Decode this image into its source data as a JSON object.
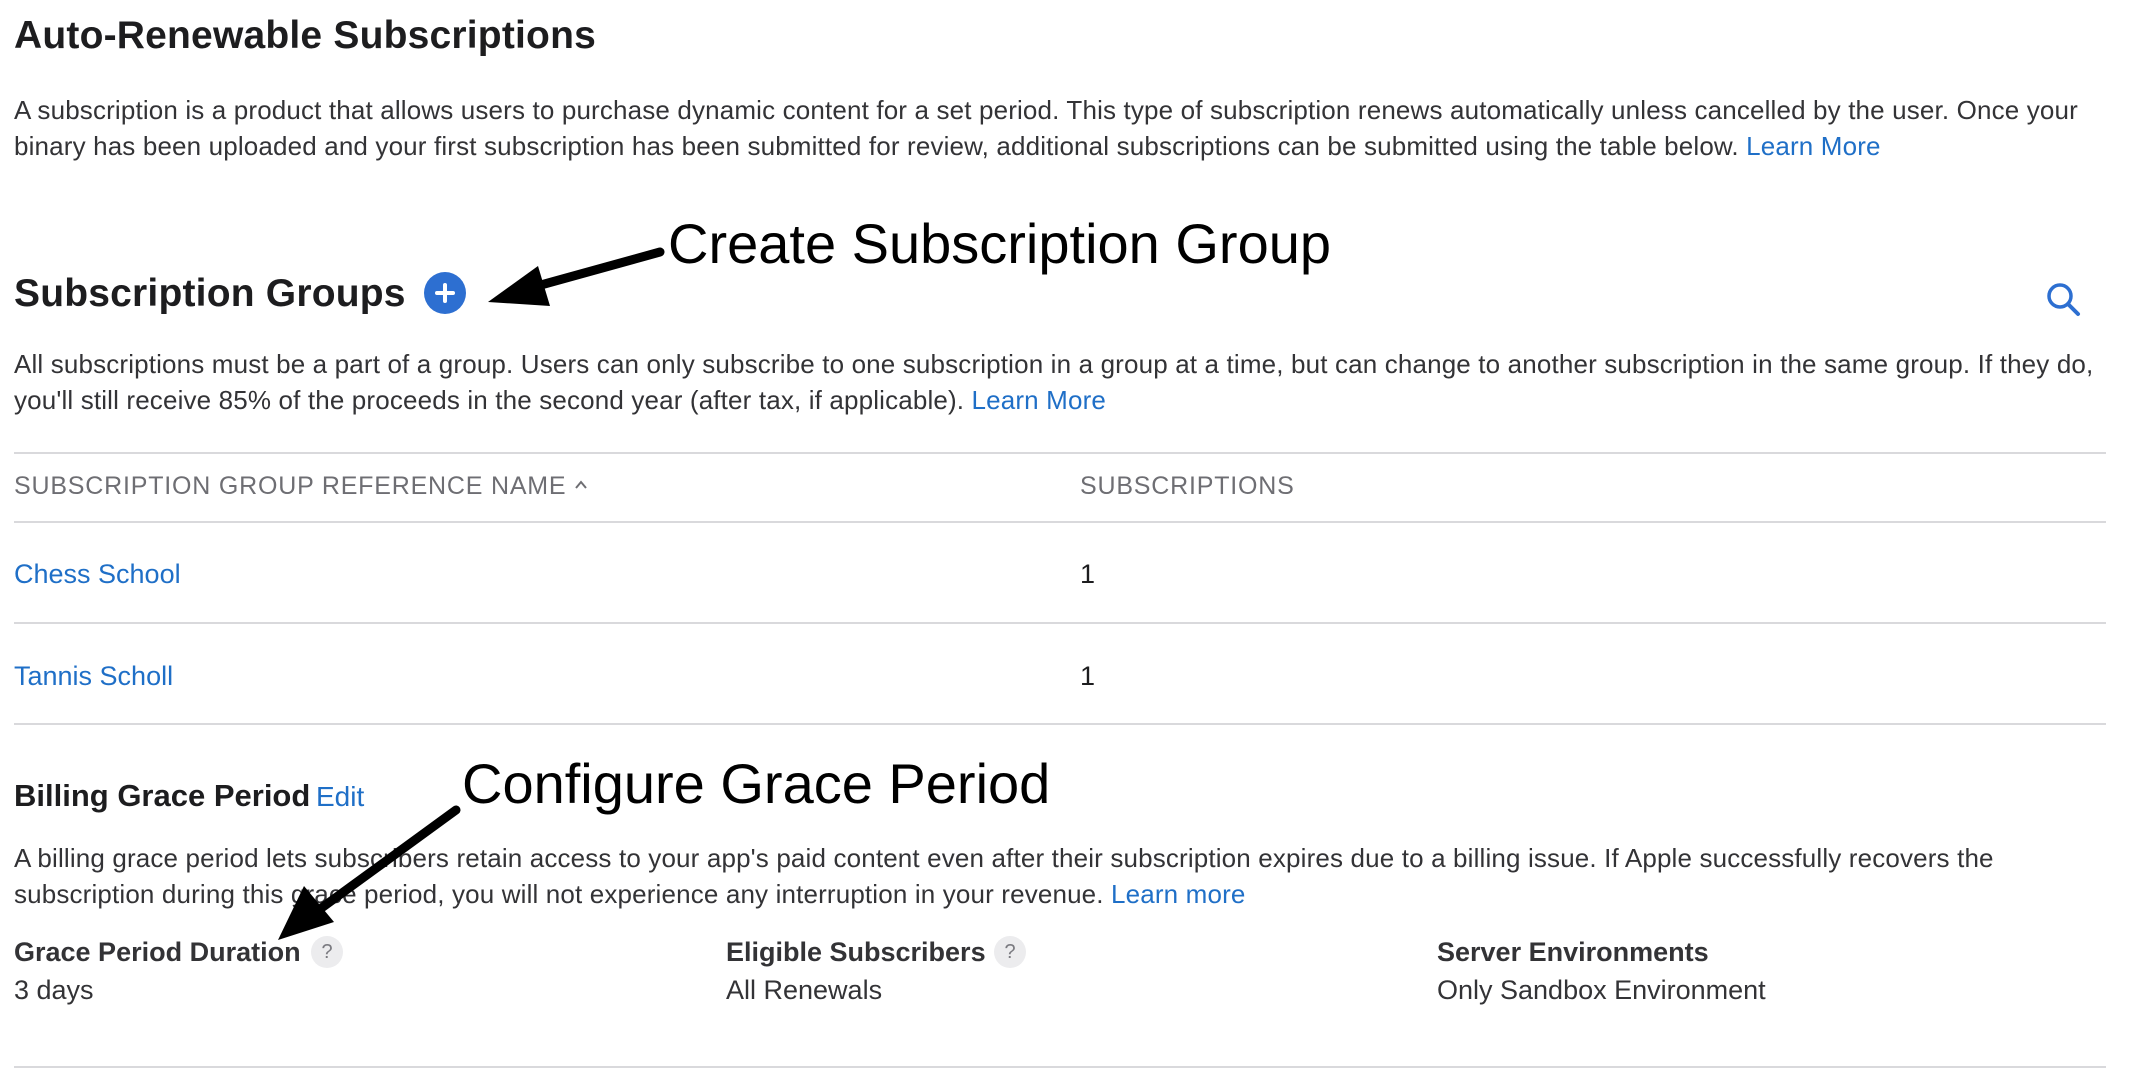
{
  "page_title": "Auto-Renewable Subscriptions",
  "intro": {
    "text": "A subscription is a product that allows users to purchase dynamic content for a set period. This type of subscription renews automatically unless cancelled by the user. Once your binary has been uploaded and your first subscription has been submitted for review, additional subscriptions can be submitted using the table below.",
    "link": "Learn More"
  },
  "groups_section": {
    "title": "Subscription Groups",
    "add_icon": "plus-circle-icon",
    "search_icon": "search-icon",
    "description": "All subscriptions must be a part of a group. Users can only subscribe to one subscription in a group at a time, but can change to another subscription in the same group. If they do, you'll still receive 85% of the proceeds in the second year (after tax, if applicable).",
    "link": "Learn More",
    "table": {
      "columns": [
        "SUBSCRIPTION GROUP REFERENCE NAME",
        "SUBSCRIPTIONS"
      ],
      "sort_icon": "chevron-up-icon",
      "rows": [
        {
          "name": "Chess School",
          "count": "1"
        },
        {
          "name": "Tannis Scholl",
          "count": "1"
        }
      ]
    }
  },
  "grace_period": {
    "title": "Billing Grace Period",
    "edit_label": "Edit",
    "description": "A billing grace period lets subscribers retain access to your app's paid content even after their subscription expires due to a billing issue. If Apple successfully recovers the subscription during this grace period, you will not experience any interruption in your revenue.",
    "link": "Learn more",
    "fields": [
      {
        "label": "Grace Period Duration",
        "value": "3 days",
        "help": "?"
      },
      {
        "label": "Eligible Subscribers",
        "value": "All Renewals",
        "help": "?"
      },
      {
        "label": "Server Environments",
        "value": "Only Sandbox Environment"
      }
    ]
  },
  "annotations": {
    "create_group": "Create Subscription Group",
    "configure_grace": "Configure Grace Period"
  },
  "colors": {
    "link": "#1f6fc7",
    "add_button": "#2d6fd1",
    "divider": "#d9d9dc",
    "annotation": "#000000"
  }
}
